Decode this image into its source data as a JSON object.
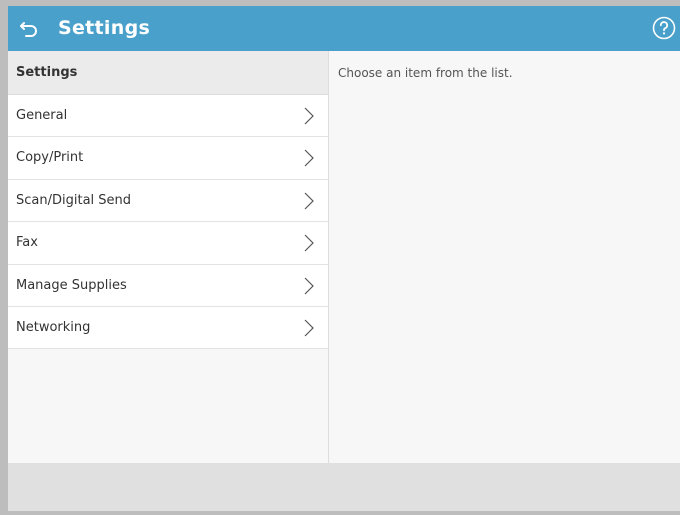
{
  "header": {
    "title": "Settings",
    "back_icon": "back-arrow-icon",
    "help_icon": "help-question-icon",
    "bg_color": "#49a0ca"
  },
  "sidebar": {
    "title": "Settings",
    "items": [
      {
        "label": "General"
      },
      {
        "label": "Copy/Print"
      },
      {
        "label": "Scan/Digital Send"
      },
      {
        "label": "Fax"
      },
      {
        "label": "Manage Supplies"
      },
      {
        "label": "Networking"
      }
    ]
  },
  "content": {
    "placeholder_text": "Choose an item from the list."
  }
}
